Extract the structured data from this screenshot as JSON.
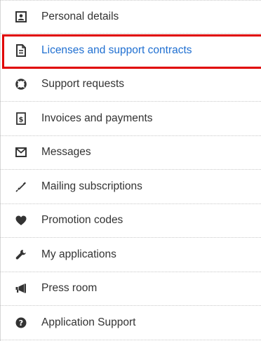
{
  "menu": {
    "items": [
      {
        "label": "Personal details",
        "icon": "id-card-icon"
      },
      {
        "label": "Licenses and support contracts",
        "icon": "document-icon",
        "active": true
      },
      {
        "label": "Support requests",
        "icon": "lifebuoy-icon"
      },
      {
        "label": "Invoices and payments",
        "icon": "invoice-dollar-icon"
      },
      {
        "label": "Messages",
        "icon": "envelope-icon"
      },
      {
        "label": "Mailing subscriptions",
        "icon": "pen-icon"
      },
      {
        "label": "Promotion codes",
        "icon": "heart-icon"
      },
      {
        "label": "My applications",
        "icon": "wrench-icon"
      },
      {
        "label": "Press room",
        "icon": "megaphone-icon"
      },
      {
        "label": "Application Support",
        "icon": "question-circle-icon"
      }
    ]
  },
  "colors": {
    "text": "#333333",
    "active_text": "#1f6fd1",
    "highlight_border": "#e00000",
    "icon": "#333333"
  }
}
